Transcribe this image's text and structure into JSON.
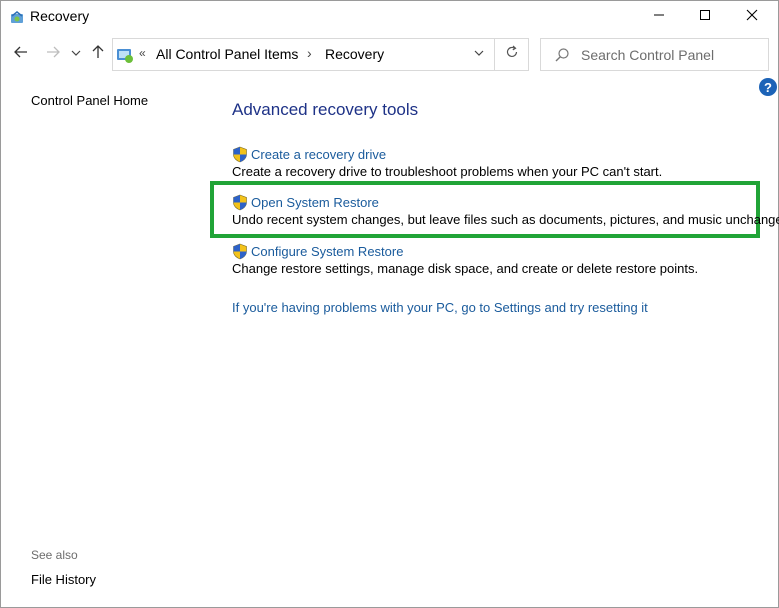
{
  "window": {
    "title": "Recovery"
  },
  "nav": {
    "breadcrumb_prefix": "«",
    "crumb1": "All Control Panel Items",
    "crumb_separator": "›",
    "crumb2": "Recovery"
  },
  "search": {
    "placeholder": "Search Control Panel"
  },
  "help": {
    "label": "?"
  },
  "sidebar": {
    "home": "Control Panel Home",
    "see_also": "See also",
    "file_history": "File History"
  },
  "main": {
    "heading": "Advanced recovery tools",
    "items": [
      {
        "link": "Create a recovery drive",
        "desc": "Create a recovery drive to troubleshoot problems when your PC can't start."
      },
      {
        "link": "Open System Restore",
        "desc": "Undo recent system changes, but leave files such as documents, pictures, and music unchanged."
      },
      {
        "link": "Configure System Restore",
        "desc": "Change restore settings, manage disk space, and create or delete restore points."
      }
    ],
    "reset_link": "If you're having problems with your PC, go to Settings and try resetting it"
  },
  "colors": {
    "link": "#1a5b9c",
    "heading": "#1e3287",
    "highlight": "#21a437",
    "help": "#1c63b7"
  },
  "icons": [
    "recovery-icon",
    "minimize-icon",
    "maximize-icon",
    "close-icon",
    "back-arrow-icon",
    "forward-arrow-icon",
    "recent-chevron-icon",
    "up-arrow-icon",
    "control-panel-icon",
    "dropdown-chevron-icon",
    "refresh-icon",
    "search-icon",
    "help-icon",
    "uac-shield-icon"
  ]
}
